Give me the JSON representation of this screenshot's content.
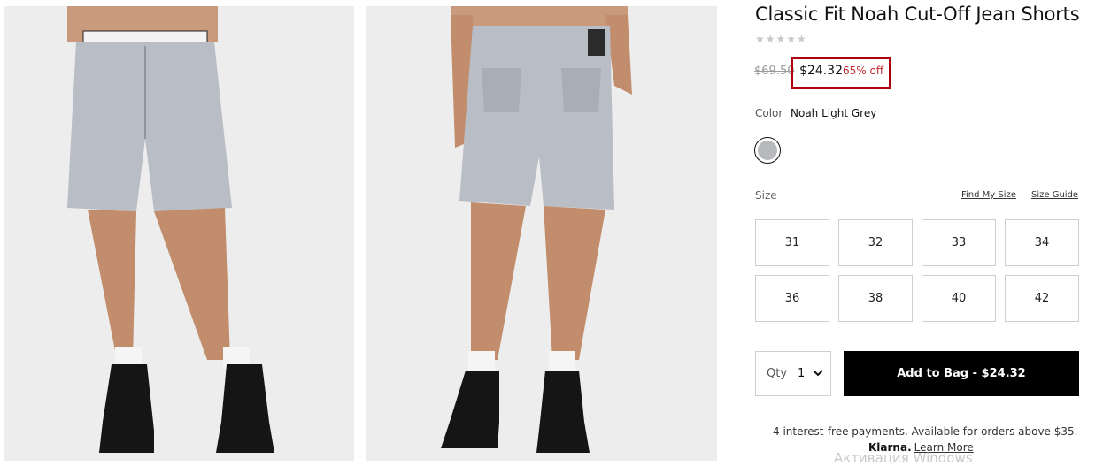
{
  "product": {
    "title": "Classic Fit Noah Cut-Off Jean Shorts",
    "rating_stars": "★★★★★",
    "original_price": "$69.50",
    "sale_price": "$24.32",
    "discount": "65% off",
    "color_label": "Color",
    "color_value": "Noah Light Grey",
    "swatch_color": "#b7b9bd"
  },
  "sizes": {
    "label": "Size",
    "find_my_size": "Find My Size",
    "size_guide": "Size Guide",
    "options": [
      "31",
      "32",
      "33",
      "34",
      "36",
      "38",
      "40",
      "42"
    ]
  },
  "purchase": {
    "qty_label": "Qty",
    "qty_value": "1",
    "add_to_bag": "Add to Bag  -  $24.32",
    "payments_text": "4 interest-free payments. Available for orders above $35.",
    "klarna_brand": "Klarna.",
    "klarna_link": "Learn More"
  },
  "os_watermark": "Активация Windows",
  "colors": {
    "highlight": "#b0000f",
    "discount": "#c0272d",
    "button_bg": "#000000"
  }
}
